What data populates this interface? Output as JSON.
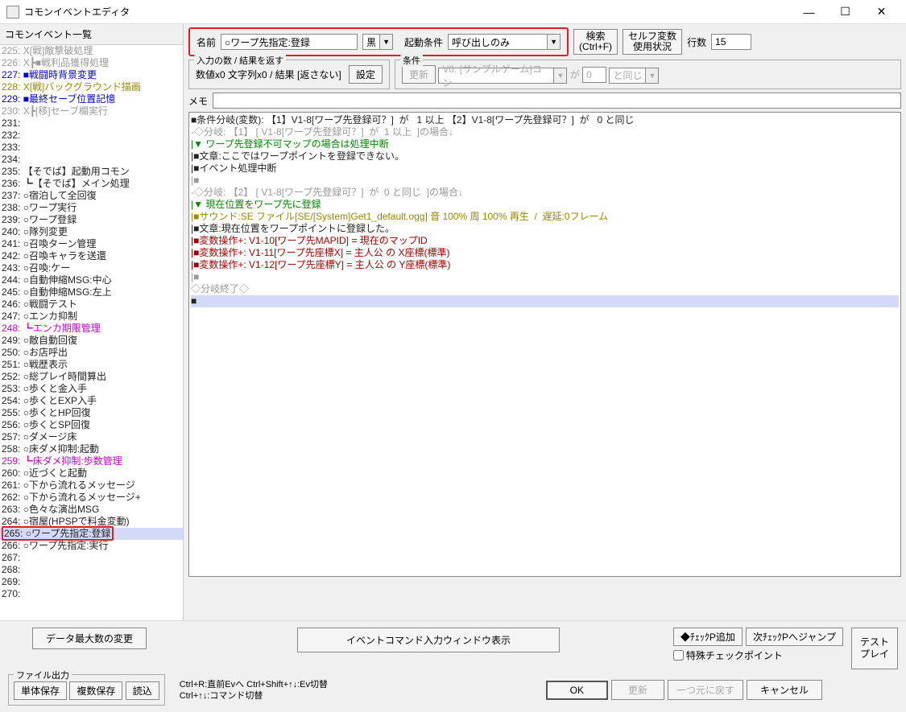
{
  "window": {
    "title": "コモンイベントエディタ"
  },
  "left": {
    "header": "コモンイベント一覧",
    "events": [
      {
        "n": "225:",
        "t": "X[戦]敵撃破処理",
        "c": "gray"
      },
      {
        "n": "226:",
        "t": "X┣■戦利品獲得処理",
        "c": "gray"
      },
      {
        "n": "227:",
        "t": "■戦闘時背景変更",
        "c": "blue"
      },
      {
        "n": "228:",
        "t": "X[戦]バックグラウンド描画",
        "c": "olive"
      },
      {
        "n": "229:",
        "t": "■最終セーブ位置記憶",
        "c": "blue"
      },
      {
        "n": "230:",
        "t": "X┣[移]セーブ欄実行",
        "c": "gray"
      },
      {
        "n": "231:",
        "t": "",
        "c": "black"
      },
      {
        "n": "232:",
        "t": "",
        "c": "black"
      },
      {
        "n": "233:",
        "t": "",
        "c": "black"
      },
      {
        "n": "234:",
        "t": "",
        "c": "black"
      },
      {
        "n": "235:",
        "t": "【そでば】起動用コモン",
        "c": "black"
      },
      {
        "n": "236:",
        "t": "┗【そでば】メイン処理",
        "c": "black"
      },
      {
        "n": "237:",
        "t": "○宿泊して全回復",
        "c": "black"
      },
      {
        "n": "238:",
        "t": "○ワープ実行",
        "c": "black"
      },
      {
        "n": "239:",
        "t": "○ワープ登録",
        "c": "black"
      },
      {
        "n": "240:",
        "t": "○隊列変更",
        "c": "black"
      },
      {
        "n": "241:",
        "t": "○召喚ターン管理",
        "c": "black"
      },
      {
        "n": "242:",
        "t": "○召喚キャラを送還",
        "c": "black"
      },
      {
        "n": "243:",
        "t": "○召喚:ケー",
        "c": "black"
      },
      {
        "n": "244:",
        "t": "○自動伸縮MSG:中心",
        "c": "black"
      },
      {
        "n": "245:",
        "t": "○自動伸縮MSG:左上",
        "c": "black"
      },
      {
        "n": "246:",
        "t": "○戦闘テスト",
        "c": "black"
      },
      {
        "n": "247:",
        "t": "○エンカ抑制",
        "c": "black"
      },
      {
        "n": "248:",
        "t": "┗エンカ期限管理",
        "c": "magenta"
      },
      {
        "n": "249:",
        "t": "○敵自動回復",
        "c": "black"
      },
      {
        "n": "250:",
        "t": "○お店呼出",
        "c": "black"
      },
      {
        "n": "251:",
        "t": "○戦歴表示",
        "c": "black"
      },
      {
        "n": "252:",
        "t": "○総プレイ時間算出",
        "c": "black"
      },
      {
        "n": "253:",
        "t": "○歩くと金入手",
        "c": "black"
      },
      {
        "n": "254:",
        "t": "○歩くとEXP入手",
        "c": "black"
      },
      {
        "n": "255:",
        "t": "○歩くとHP回復",
        "c": "black"
      },
      {
        "n": "256:",
        "t": "○歩くとSP回復",
        "c": "black"
      },
      {
        "n": "257:",
        "t": "○ダメージ床",
        "c": "black"
      },
      {
        "n": "258:",
        "t": "○床ダメ抑制:起動",
        "c": "black"
      },
      {
        "n": "259:",
        "t": "┗床ダメ抑制:歩数管理",
        "c": "magenta"
      },
      {
        "n": "260:",
        "t": "○近づくと起動",
        "c": "black"
      },
      {
        "n": "261:",
        "t": "○下から流れるメッセージ",
        "c": "black"
      },
      {
        "n": "262:",
        "t": "○下から流れるメッセージ+",
        "c": "black"
      },
      {
        "n": "263:",
        "t": "○色々な演出MSG",
        "c": "black"
      },
      {
        "n": "264:",
        "t": "○宿屋(HPSPで料金変動)",
        "c": "black"
      },
      {
        "n": "265:",
        "t": "○ワープ先指定:登録",
        "c": "black",
        "sel": true,
        "box": true
      },
      {
        "n": "266:",
        "t": "○ワープ先指定:実行",
        "c": "black"
      },
      {
        "n": "267:",
        "t": "",
        "c": "black"
      },
      {
        "n": "268:",
        "t": "",
        "c": "black"
      },
      {
        "n": "269:",
        "t": "",
        "c": "black"
      },
      {
        "n": "270:",
        "t": "",
        "c": "black"
      }
    ]
  },
  "top": {
    "name_label": "名前",
    "name_value": "○ワープ先指定:登録",
    "color_label": "黒",
    "trigger_label": "起動条件",
    "trigger_value": "呼び出しのみ",
    "search_btn": "検索\n(Ctrl+F)",
    "selfvar_btn": "セルフ変数\n使用状況",
    "lines_label": "行数",
    "lines_value": "15"
  },
  "io": {
    "legend": "入力の数 / 結果を返す",
    "text": "数値x0 文字列x0 / 結果 [返さない]",
    "setting_btn": "設定"
  },
  "cond": {
    "legend": "条件",
    "update_btn": "更新",
    "var_value": "V0: [サンプルゲーム]コン",
    "ga": "が",
    "num": "0",
    "op": "と同じ"
  },
  "memo": {
    "label": "メモ",
    "value": ""
  },
  "code": [
    {
      "t": "■条件分岐(変数): 【1】V1-8[ワープ先登録可？]  が   1 以上 【2】V1-8[ワープ先登録可？]  が   0 と同じ",
      "c": "black"
    },
    {
      "t": "-◇分岐: 【1】 [ V1-8[ワープ先登録可？]  が  1 以上  ]の場合↓",
      "c": "gray"
    },
    {
      "t": "|▼ ワープ先登録不可マップの場合は処理中断",
      "c": "green"
    },
    {
      "t": "|■文章:ここではワープポイントを登録できない。",
      "c": "black"
    },
    {
      "t": "|■イベント処理中断",
      "c": "black"
    },
    {
      "t": "|■",
      "c": "gray"
    },
    {
      "t": "-◇分岐: 【2】 [ V1-8[ワープ先登録可？]  が  0 と同じ  ]の場合↓",
      "c": "gray"
    },
    {
      "t": "|▼ 現在位置をワープ先に登録",
      "c": "green"
    },
    {
      "t": "|■サウンド:SE ファイル[SE/[System]Get1_default.ogg] 音 100% 周 100% 再生  /  遅延:0フレーム",
      "c": "olive"
    },
    {
      "t": "|■文章:現在位置をワープポイントに登録した。",
      "c": "black"
    },
    {
      "t": "|■変数操作+: V1-10[ワープ先MAPID] = 現在のマップID",
      "c": "darkred"
    },
    {
      "t": "|■変数操作+: V1-11[ワープ先座標X] = 主人公 の X座標(標準)",
      "c": "darkred"
    },
    {
      "t": "|■変数操作+: V1-12[ワープ先座標Y] = 主人公 の Y座標(標準)",
      "c": "darkred"
    },
    {
      "t": "|■",
      "c": "gray"
    },
    {
      "t": "◇分岐終了◇",
      "c": "gray"
    },
    {
      "t": "■",
      "c": "black",
      "sel": true
    }
  ],
  "bottom": {
    "data_max_btn": "データ最大数の変更",
    "cmd_window_btn": "イベントコマンド入力ウィンドウ表示",
    "add_cp_btn": "◆ﾁｪｯｸP追加",
    "next_cp_btn": "次ﾁｪｯｸPへジャンプ",
    "special_cp": "特殊チェックポイント",
    "test_play_btn": "テスト\nプレイ",
    "file_output_legend": "ファイル出力",
    "single_save": "単体保存",
    "multi_save": "複数保存",
    "load": "読込",
    "hint1": "Ctrl+R:直前Evへ  Ctrl+Shift+↑↓:Ev切替",
    "hint2": "Ctrl+↑↓:コマンド切替",
    "ok_btn": "OK",
    "update_btn": "更新",
    "undo_btn": "一つ元に戻す",
    "cancel_btn": "キャンセル"
  }
}
